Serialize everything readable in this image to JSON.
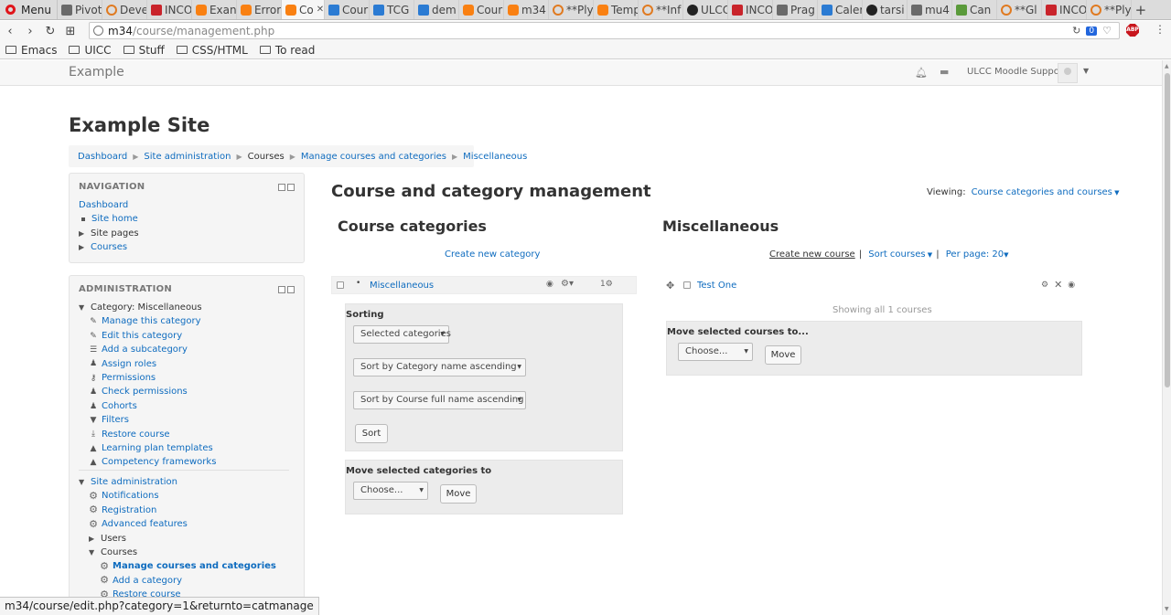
{
  "browser": {
    "menu_label": "Menu",
    "tabs": [
      {
        "label": "Pivot",
        "icon": "document-icon"
      },
      {
        "label": "Deve",
        "icon": "ring-icon"
      },
      {
        "label": "INCO",
        "icon": "mail-icon"
      },
      {
        "label": "Exan",
        "icon": "moodle-icon"
      },
      {
        "label": "Error",
        "icon": "moodle-icon"
      },
      {
        "label": "Co",
        "icon": "moodle-icon",
        "active": true
      },
      {
        "label": "Cour",
        "icon": "blue-b-icon"
      },
      {
        "label": "TCG",
        "icon": "blue-b-icon"
      },
      {
        "label": "dem",
        "icon": "blue-b-icon"
      },
      {
        "label": "Cour",
        "icon": "moodle-icon"
      },
      {
        "label": "m34",
        "icon": "moodle-icon"
      },
      {
        "label": "**Ply",
        "icon": "ring-icon"
      },
      {
        "label": "Temp",
        "icon": "moodle-icon"
      },
      {
        "label": "**Inf",
        "icon": "ring-icon"
      },
      {
        "label": "ULCC",
        "icon": "github-icon"
      },
      {
        "label": "INCO",
        "icon": "mail-icon"
      },
      {
        "label": "Prag",
        "icon": "book-icon"
      },
      {
        "label": "Caler",
        "icon": "outlook-icon"
      },
      {
        "label": "tarsi",
        "icon": "github-icon"
      },
      {
        "label": "mu4",
        "icon": "document-icon"
      },
      {
        "label": "Can",
        "icon": "leaf-icon"
      },
      {
        "label": "**Gl",
        "icon": "ring-icon"
      },
      {
        "label": "INCO",
        "icon": "mail-icon"
      },
      {
        "label": "**Ply",
        "icon": "ring-icon"
      }
    ],
    "url_host": "m34",
    "url_path": "/course/management.php",
    "url_badge": "0",
    "bookmarks": [
      "Emacs",
      "UICC",
      "Stuff",
      "CSS/HTML",
      "To read"
    ],
    "status_url": "m34/course/edit.php?category=1&returnto=catmanage"
  },
  "navbar": {
    "brand": "Example",
    "user_name": "ULCC Moodle Support"
  },
  "site_title": "Example Site",
  "breadcrumb": [
    "Dashboard",
    "Site administration",
    "Courses",
    "Manage courses and categories",
    "Miscellaneous"
  ],
  "navigation": {
    "title": "NAVIGATION",
    "dashboard": "Dashboard",
    "items": [
      "Site home",
      "Site pages",
      "Courses"
    ]
  },
  "administration": {
    "title": "ADMINISTRATION",
    "category_label": "Category: Miscellaneous",
    "category_items": [
      "Manage this category",
      "Edit this category",
      "Add a subcategory",
      "Assign roles",
      "Permissions",
      "Check permissions",
      "Cohorts",
      "Filters",
      "Restore course",
      "Learning plan templates",
      "Competency frameworks"
    ],
    "site_admin": "Site administration",
    "site_items": [
      "Notifications",
      "Registration",
      "Advanced features",
      "Users",
      "Courses"
    ],
    "course_items": [
      "Manage courses and categories",
      "Add a category",
      "Restore course"
    ]
  },
  "main": {
    "title": "Course and category management",
    "viewing_label": "Viewing:",
    "viewing_value": "Course categories and courses",
    "categories_heading": "Course categories",
    "create_category": "Create new category",
    "category_name": "Miscellaneous",
    "category_count": "1",
    "sorting_label": "Sorting",
    "sort_select_1": "Selected categories",
    "sort_select_2": "Sort by Category name ascending",
    "sort_select_3": "Sort by Course full name ascending",
    "sort_button": "Sort",
    "move_categories_label": "Move selected categories to",
    "move_choose": "Choose...",
    "move_button": "Move",
    "courses_heading": "Miscellaneous",
    "create_course": "Create new course",
    "sort_courses": "Sort courses",
    "per_page": "Per page: 20",
    "course_name": "Test One",
    "showing": "Showing all 1 courses",
    "move_courses_label": "Move selected courses to...",
    "move_courses_choose": "Choose...",
    "move_courses_button": "Move"
  }
}
